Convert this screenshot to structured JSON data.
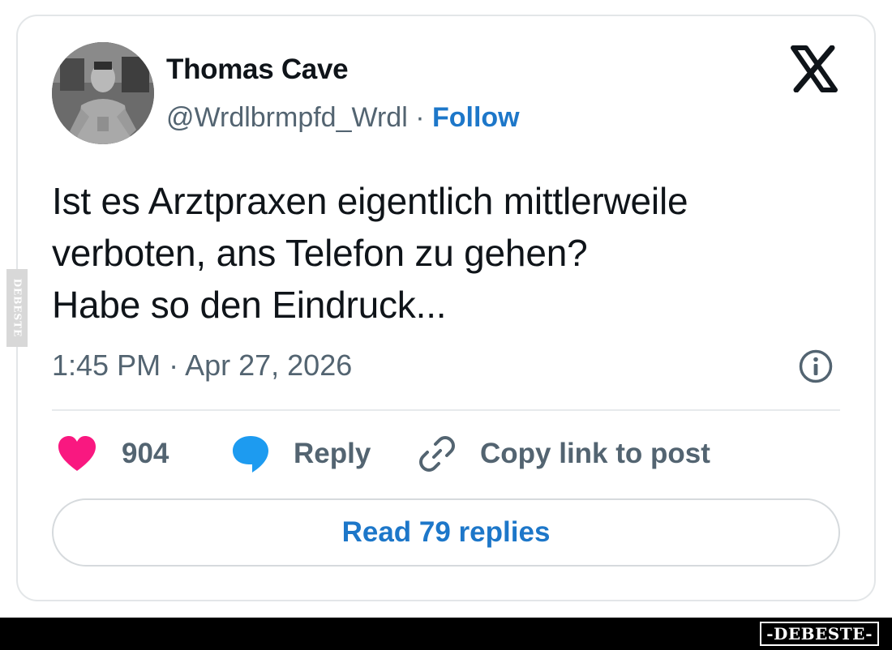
{
  "author": {
    "name": "Thomas Cave",
    "handle": "@Wrdlbrmpfd_Wrdl",
    "separator": " · ",
    "follow_label": "Follow"
  },
  "platform_icon": "x-logo-icon",
  "tweet": {
    "lines": [
      "Ist es Arztpraxen eigentlich mittlerweile",
      "verboten, ans Telefon zu gehen?",
      "Habe so den Eindruck..."
    ],
    "timestamp": "1:45 PM · Apr 27, 2026"
  },
  "actions": {
    "like_count": "904",
    "reply_label": "Reply",
    "copy_label": "Copy link to post"
  },
  "read_replies_label": "Read 79 replies",
  "watermark": {
    "side": "DEBESTE",
    "footer": "-DEBESTE-"
  },
  "colors": {
    "like": "#f91880",
    "reply": "#1d9bf0",
    "link": "#1d77c9",
    "text": "#0f1419",
    "muted": "#536471"
  }
}
